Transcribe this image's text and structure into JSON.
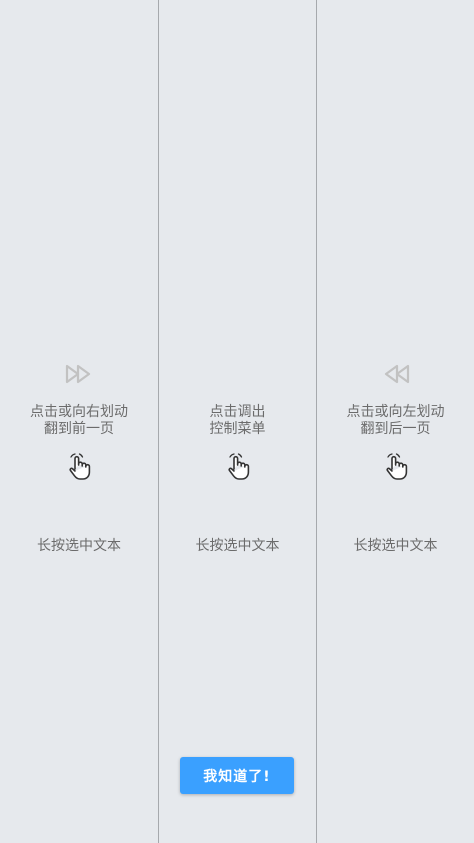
{
  "zones": [
    {
      "arrow_icon": "fast-forward-icon",
      "hint_lines": [
        "点击或向右划动",
        "翻到前一页"
      ],
      "gesture_icon": "tap-hand-icon",
      "long_press": "长按选中文本"
    },
    {
      "hint_lines": [
        "点击调出",
        "控制菜单"
      ],
      "gesture_icon": "tap-hand-icon",
      "long_press": "长按选中文本"
    },
    {
      "arrow_icon": "rewind-icon",
      "hint_lines": [
        "点击或向左划动",
        "翻到后一页"
      ],
      "gesture_icon": "tap-hand-icon",
      "long_press": "长按选中文本"
    }
  ],
  "confirm_button": {
    "label": "我知道了!"
  },
  "colors": {
    "background": "#e6e9ed",
    "divider": "#a6a9ad",
    "hint_text": "#6b6b6b",
    "button": "#3aa0ff",
    "button_text": "#ffffff"
  }
}
